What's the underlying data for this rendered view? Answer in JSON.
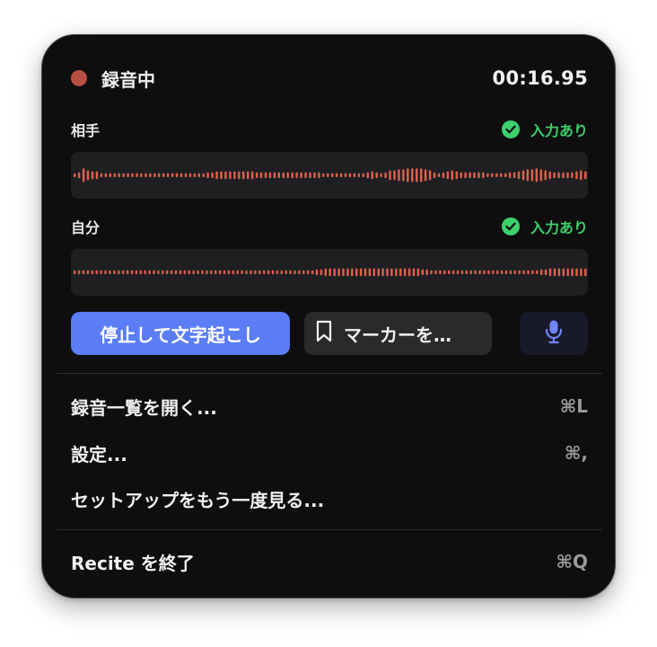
{
  "recording": {
    "status_label": "録音中",
    "elapsed": "00:16.95",
    "indicator_color": "#b84f45"
  },
  "channels": [
    {
      "label": "相手",
      "status": "入力あり",
      "status_icon": "check-circle-icon",
      "waveform_color": "#e0624f"
    },
    {
      "label": "自分",
      "status": "入力あり",
      "status_icon": "check-circle-icon",
      "waveform_color": "#e0624f"
    }
  ],
  "actions": {
    "stop_label": "停止して文字起こし",
    "stop_color": "#5b7df5",
    "marker_label": "マーカーを…",
    "marker_icon": "bookmark-icon",
    "mic_icon": "microphone-icon",
    "mic_color": "#6f86f7"
  },
  "menu": [
    {
      "label": "録音一覧を開く...",
      "shortcut": "⌘L"
    },
    {
      "label": "設定...",
      "shortcut": "⌘,"
    },
    {
      "label": "セットアップをもう一度見る...",
      "shortcut": ""
    },
    {
      "label": "Recite を終了",
      "shortcut": "⌘Q"
    }
  ],
  "status_color": "#3fcf6a"
}
